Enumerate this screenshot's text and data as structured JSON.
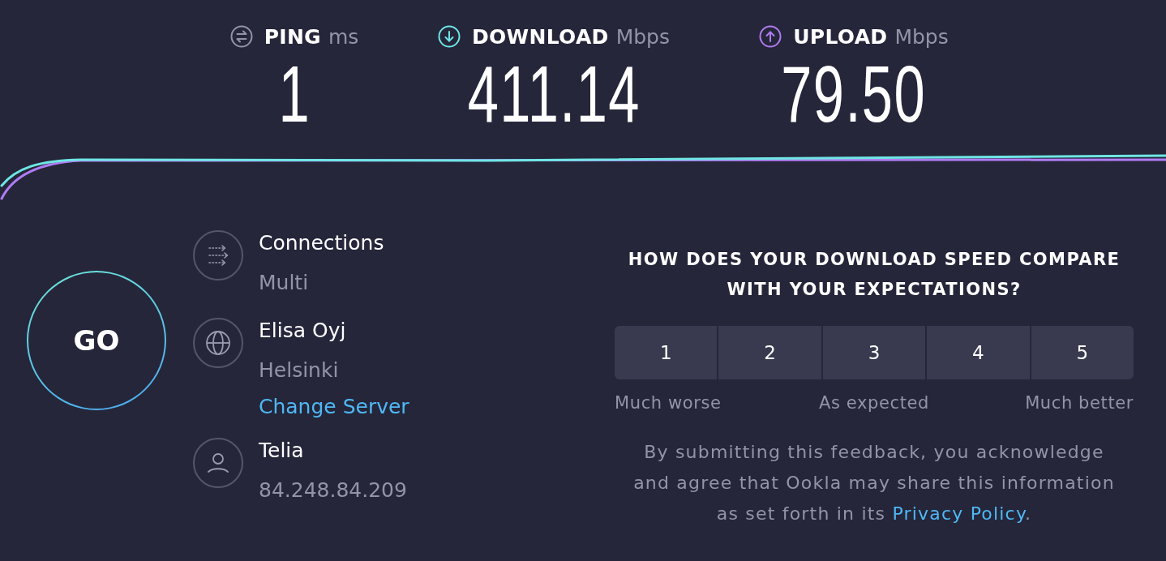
{
  "metrics": [
    {
      "kind": "ping",
      "label": "PING",
      "unit": "ms",
      "value": "1",
      "color": "#9394a8"
    },
    {
      "kind": "download",
      "label": "DOWNLOAD",
      "unit": "Mbps",
      "value": "411.14",
      "color": "#6fe6e4"
    },
    {
      "kind": "upload",
      "label": "UPLOAD",
      "unit": "Mbps",
      "value": "79.50",
      "color": "#b07cf3"
    }
  ],
  "go_button": {
    "label": "GO"
  },
  "server_info": [
    {
      "kind": "connections",
      "title": "Connections",
      "subtitle": "Multi"
    },
    {
      "kind": "server",
      "title": "Elisa Oyj",
      "subtitle": "Helsinki",
      "link": "Change Server"
    },
    {
      "kind": "provider",
      "title": "Telia",
      "subtitle": "84.248.84.209"
    }
  ],
  "feedback": {
    "question": "HOW DOES YOUR DOWNLOAD SPEED COMPARE WITH YOUR EXPECTATIONS?",
    "ratings": [
      {
        "label": "1",
        "selected": false
      },
      {
        "label": "2",
        "selected": false
      },
      {
        "label": "3",
        "selected": false
      },
      {
        "label": "4",
        "selected": false
      },
      {
        "label": "5",
        "selected": false
      }
    ],
    "scale_labels": [
      "Much worse",
      "As expected",
      "Much better"
    ],
    "disclaimer": "By submitting this feedback, you acknowledge and agree that Ookla may share this information as set forth in its",
    "policy_link": "Privacy Policy",
    "disclaimer_end": "."
  }
}
